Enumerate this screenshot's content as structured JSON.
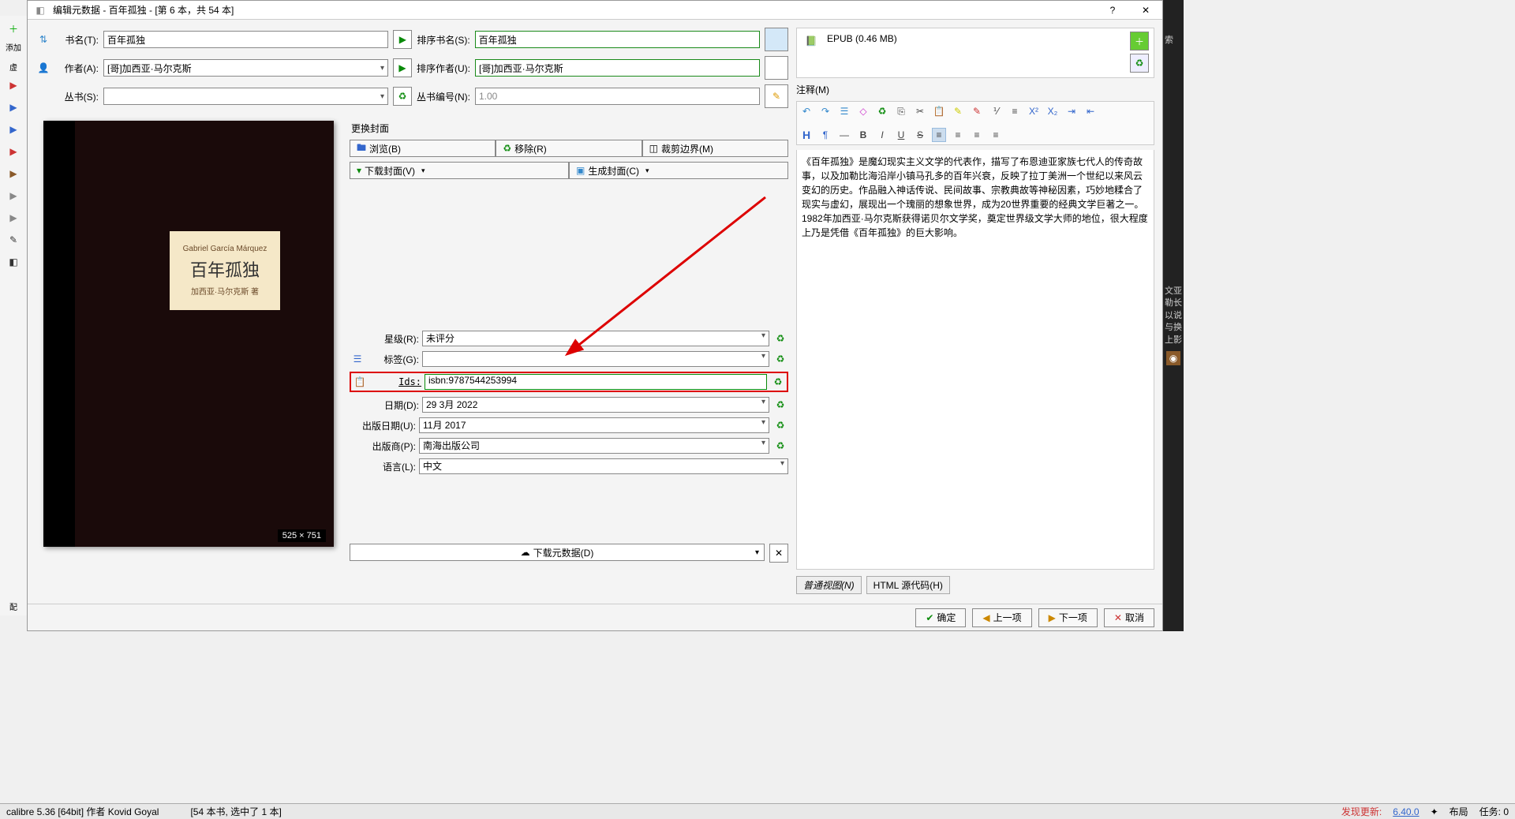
{
  "window": {
    "title": "编辑元数据 - 百年孤独 -  [第 6 本，共 54 本]",
    "help": "?",
    "close": "✕"
  },
  "sidebar": {
    "add": "添加",
    "virtual": "虚",
    "cfg": "配"
  },
  "fields": {
    "title_label": "书名(T):",
    "title": "百年孤独",
    "author_label": "作者(A):",
    "author": "[哥]加西亚·马尔克斯",
    "series_label": "丛书(S):",
    "series": "",
    "sort_title_label": "排序书名(S):",
    "sort_title": "百年孤独",
    "sort_author_label": "排序作者(U):",
    "sort_author": "[哥]加西亚·马尔克斯",
    "series_num_label": "丛书编号(N):",
    "series_num": "1.00"
  },
  "cover": {
    "section_label": "更换封面",
    "browse": "浏览(B)",
    "remove": "移除(R)",
    "trim": "裁剪边界(M)",
    "download": "下载封面(V)",
    "generate": "生成封面(C)",
    "author_en": "Gabriel García Márquez",
    "title_cn": "百年孤独",
    "author_cn": "加西亚·马尔克斯 著",
    "dims": "525 × 751"
  },
  "meta": {
    "rating_label": "星级(R):",
    "rating": "未评分",
    "tags_label": "标签(G):",
    "tags": "",
    "ids_label": "Ids:",
    "ids": "isbn:9787544253994",
    "date_label": "日期(D):",
    "date": "29 3月 2022",
    "pubdate_label": "出版日期(U):",
    "pubdate": "11月 2017",
    "publisher_label": "出版商(P):",
    "publisher": "南海出版公司",
    "language_label": "语言(L):",
    "language": "中文",
    "download_meta": "下载元数据(D)"
  },
  "formats": {
    "epub_badge": "EPUB",
    "epub": "EPUB (0.46 MB)"
  },
  "notes": {
    "label": "注释(M)",
    "text": "《百年孤独》是魔幻现实主义文学的代表作，描写了布恩迪亚家族七代人的传奇故事，以及加勒比海沿岸小镇马孔多的百年兴衰，反映了拉丁美洲一个世纪以来风云变幻的历史。作品融入神话传说、民间故事、宗教典故等神秘因素，巧妙地糅合了现实与虚幻，展现出一个瑰丽的想象世界，成为20世界重要的经典文学巨著之一。1982年加西亚·马尔克斯获得诺贝尔文学奖，奠定世界级文学大师的地位，很大程度上乃是凭借《百年孤独》的巨大影响。",
    "tab_normal": "普通视图(N)",
    "tab_html": "HTML 源代码(H)"
  },
  "footer": {
    "ok": "确定",
    "prev": "上一项",
    "next": "下一项",
    "cancel": "取消"
  },
  "status": {
    "left": "calibre 5.36 [64bit] 作者 Kovid Goyal",
    "mid": "[54 本书, 选中了 1 本]",
    "r1": "发现更新:",
    "r2": "6.40.0",
    "r3": "布局",
    "r4": "任务:  0"
  },
  "rightstrip": {
    "t1": "索",
    "t2": "文亚勒长以说与换上影"
  }
}
